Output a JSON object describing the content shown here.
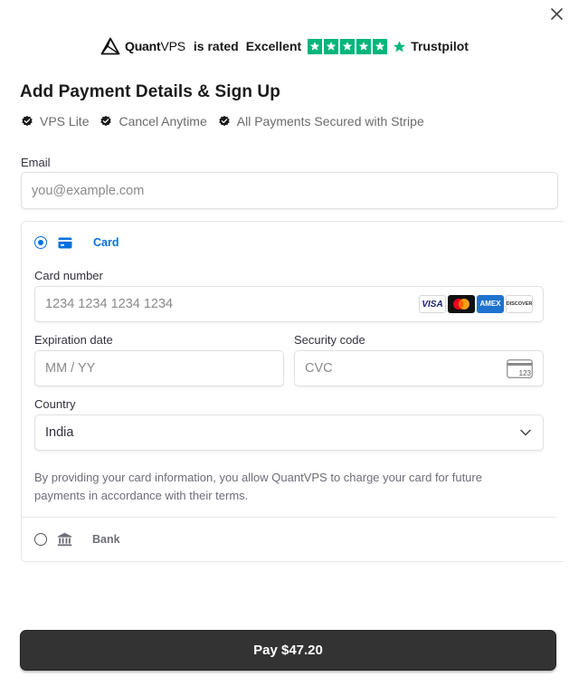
{
  "header": {
    "brand_bold": "Quant",
    "brand_light": "VPS",
    "is_rated": "is rated",
    "rating_word": "Excellent",
    "stars": 5,
    "trustpilot": "Trustpilot",
    "star_color": "#00b67a"
  },
  "close_icon": "close-icon",
  "title": "Add Payment Details & Sign Up",
  "features": [
    "VPS Lite",
    "Cancel Anytime",
    "All Payments Secured with Stripe"
  ],
  "email": {
    "label": "Email",
    "placeholder": "you@example.com",
    "value": ""
  },
  "payment_methods": {
    "card": {
      "label": "Card",
      "selected": true,
      "card_number_label": "Card number",
      "card_number_placeholder": "1234 1234 1234 1234",
      "card_brands": [
        "VISA",
        "mastercard",
        "AMEX",
        "DISCOVER"
      ],
      "expiration_label": "Expiration date",
      "expiration_placeholder": "MM / YY",
      "security_label": "Security code",
      "security_placeholder": "CVC",
      "cvc_icon_text": "123",
      "country_label": "Country",
      "country_value": "India",
      "note": "By providing your card information, you allow QuantVPS to charge your card for future payments in accordance with their terms."
    },
    "bank": {
      "label": "Bank",
      "selected": false
    }
  },
  "accent_color": "#0570de",
  "pay_button": {
    "label": "Pay $47.20",
    "color": "#333333"
  }
}
